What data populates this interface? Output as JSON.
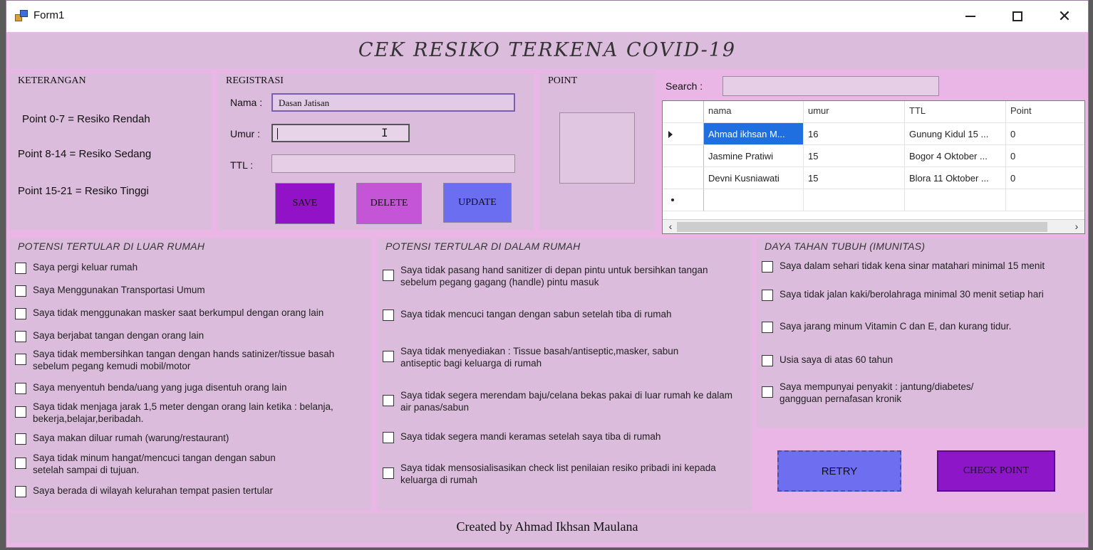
{
  "window": {
    "title": "Form1"
  },
  "header": {
    "title": "CEK RESIKO TERKENA COVID-19"
  },
  "keterangan": {
    "label": "KETERANGAN",
    "lines": [
      "Point 0-7  = Resiko Rendah",
      "Point 8-14 = Resiko Sedang",
      "Point 15-21 = Resiko Tinggi"
    ]
  },
  "registrasi": {
    "label": "REGISTRASI",
    "nama_label": "Nama :",
    "nama_value": "Dasan Jatisan",
    "umur_label": "Umur :",
    "umur_value": "",
    "ttl_label": "TTL :",
    "ttl_value": "",
    "save_label": "SAVE",
    "delete_label": "DELETE",
    "update_label": "UPDATE"
  },
  "point": {
    "label": "POINT"
  },
  "search": {
    "label": "Search :",
    "value": ""
  },
  "grid": {
    "columns": [
      "nama",
      "umur",
      "TTL",
      "Point"
    ],
    "rows": [
      [
        "Ahmad ikhsan M...",
        "16",
        "Gunung Kidul 15 ...",
        "0"
      ],
      [
        "Jasmine Pratiwi",
        "15",
        "Bogor 4 Oktober ...",
        "0"
      ],
      [
        "Devni Kusniawati",
        "15",
        "Blora 11 Oktober ...",
        "0"
      ]
    ]
  },
  "luar_rumah": {
    "label": "POTENSI TERTULAR DI LUAR RUMAH",
    "items": [
      "Saya pergi keluar rumah",
      "Saya Menggunakan Transportasi Umum",
      "Saya tidak menggunakan masker saat berkumpul dengan orang lain",
      "Saya berjabat tangan dengan orang lain",
      "Saya tidak membersihkan tangan dengan hands satinizer/tissue basah sebelum pegang  kemudi mobil/motor",
      "Saya menyentuh benda/uang yang juga disentuh orang lain",
      "Saya tidak menjaga jarak 1,5 meter dengan orang lain ketika : belanja, bekerja,belajar,beribadah.",
      "Saya makan diluar rumah (warung/restaurant)",
      "Saya tidak minum hangat/mencuci tangan dengan sabun setelah sampai di tujuan.",
      "Saya berada di wilayah kelurahan tempat pasien tertular"
    ]
  },
  "dalam_rumah": {
    "label": "POTENSI TERTULAR DI DALAM RUMAH",
    "items": [
      "Saya tidak pasang hand sanitizer di depan pintu untuk bersihkan tangan sebelum pegang gagang (handle) pintu masuk",
      "Saya tidak mencuci tangan dengan sabun setelah tiba di rumah",
      "Saya tidak menyediakan : Tissue basah/antiseptic,masker, sabun antiseptic bagi keluarga di rumah",
      "Saya tidak segera merendam baju/celana bekas pakai di luar rumah ke dalam air panas/sabun",
      "Saya tidak segera mandi keramas setelah saya tiba di rumah",
      "Saya tidak mensosialisasikan check list penilaian resiko pribadi ini kepada keluarga di rumah"
    ]
  },
  "imunitas": {
    "label": "DAYA TAHAN TUBUH (IMUNITAS)",
    "items": [
      "Saya dalam sehari tidak kena sinar matahari minimal 15 menit",
      "Saya tidak jalan kaki/berolahraga minimal 30 menit setiap hari",
      "Saya jarang minum Vitamin C dan E, dan kurang tidur.",
      "Usia saya di atas 60 tahun",
      "Saya mempunyai penyakit : jantung/diabetes/ gangguan pernafasan kronik"
    ]
  },
  "actions": {
    "retry_label": "RETRY",
    "check_label": "CHECK POINT"
  },
  "footer": {
    "text": "Created by Ahmad Ikhsan Maulana"
  }
}
